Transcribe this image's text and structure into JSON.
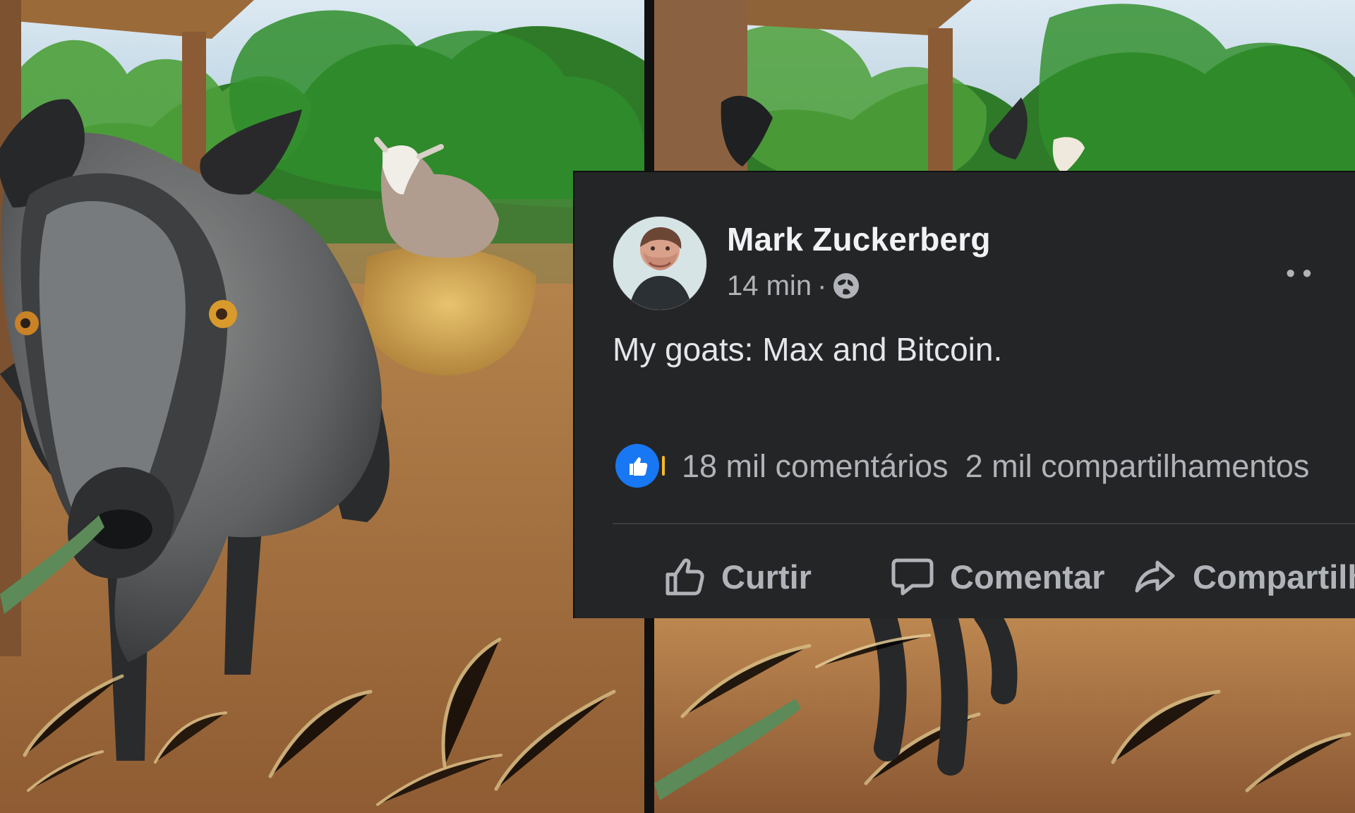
{
  "photos": {
    "left_alt": "A young gray goat standing in a pen with straw and a second goat behind it",
    "right_alt": "A duplicate goat photo partially covered by a Facebook post card"
  },
  "post": {
    "author_name": "Mark Zuckerberg",
    "time": "14 min",
    "meta_separator": "·",
    "privacy_icon": "globe-icon",
    "more_icon": "more-horizontal-icon",
    "text": "My goats: Max and Bitcoin.",
    "reactions": {
      "icon": "like-reaction-icon",
      "comments": "18 mil comentários",
      "shares": "2 mil compartilhamentos"
    },
    "actions": {
      "like": "Curtir",
      "comment": "Comentar",
      "share": "Compartilhar"
    }
  },
  "colors": {
    "card_bg": "#242526",
    "text_primary": "#e4e6eb",
    "text_secondary": "#b0b3b8",
    "facebook_blue": "#1877f2"
  }
}
